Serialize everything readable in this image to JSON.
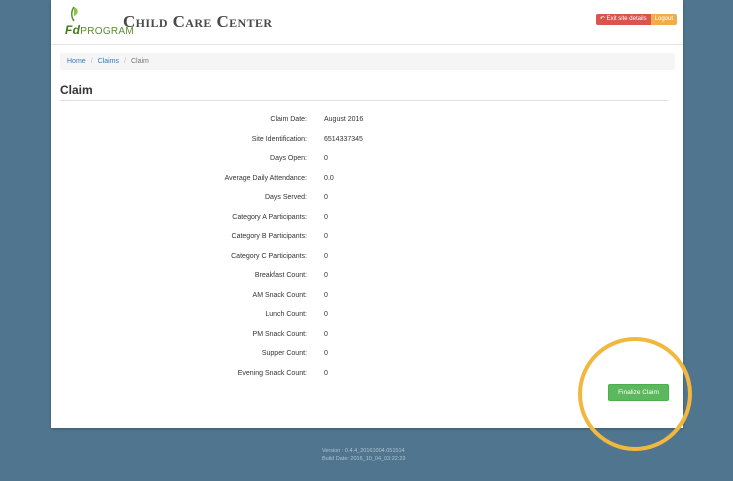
{
  "header": {
    "logo_text_prefix": "Fd",
    "logo_text_suffix": "PROGRAM",
    "brand": "Child Care Center",
    "exit_label": "Exit site details",
    "logout_label": "Logout"
  },
  "breadcrumb": {
    "items": [
      "Home",
      "Claims",
      "Claim"
    ]
  },
  "page": {
    "title": "Claim"
  },
  "claim": {
    "rows": [
      {
        "label": "Claim Date:",
        "value": "August 2016"
      },
      {
        "label": "Site Identification:",
        "value": "6514337345"
      },
      {
        "label": "Days Open:",
        "value": "0"
      },
      {
        "label": "Average Daily Attendance:",
        "value": "0.0"
      },
      {
        "label": "Days Served:",
        "value": "0"
      },
      {
        "label": "Category A Participants:",
        "value": "0"
      },
      {
        "label": "Category B Participants:",
        "value": "0"
      },
      {
        "label": "Category C Participants:",
        "value": "0"
      },
      {
        "label": "Breakfast Count:",
        "value": "0"
      },
      {
        "label": "AM Snack Count:",
        "value": "0"
      },
      {
        "label": "Lunch Count:",
        "value": "0"
      },
      {
        "label": "PM Snack Count:",
        "value": "0"
      },
      {
        "label": "Supper Count:",
        "value": "0"
      },
      {
        "label": "Evening Snack Count:",
        "value": "0"
      }
    ],
    "finalize_label": "Finalize Claim"
  },
  "footer": {
    "version": "Version : 0.4.4_20161004.051514",
    "build_date": "Build Date: 2016_10_04_03:22:23"
  },
  "colors": {
    "background": "#50768f",
    "finalize": "#5cb85c",
    "exit": "#d9534f",
    "logout": "#f0ad4e",
    "highlight": "#f2b73f"
  }
}
